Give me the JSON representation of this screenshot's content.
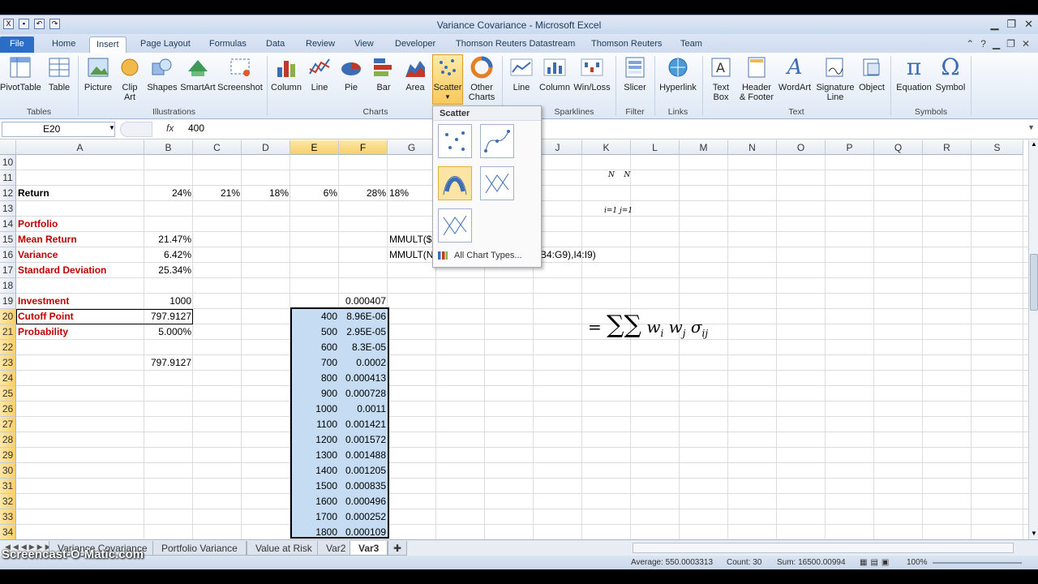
{
  "window": {
    "title": "Variance Covariance - Microsoft Excel"
  },
  "tabs": [
    "File",
    "Home",
    "Insert",
    "Page Layout",
    "Formulas",
    "Data",
    "Review",
    "View",
    "Developer",
    "Thomson Reuters Datastream",
    "Thomson Reuters",
    "Team"
  ],
  "ribbon": {
    "groups": {
      "tables": "Tables",
      "illustrations": "Illustrations",
      "charts": "Charts",
      "sparklines": "Sparklines",
      "filter": "Filter",
      "links": "Links",
      "text": "Text",
      "symbols": "Symbols"
    },
    "buttons": {
      "pivottable": "PivotTable",
      "table": "Table",
      "picture": "Picture",
      "clipart1": "Clip",
      "clipart2": "Art",
      "shapes": "Shapes",
      "smartart": "SmartArt",
      "screenshot": "Screenshot",
      "column": "Column",
      "line": "Line",
      "pie": "Pie",
      "bar": "Bar",
      "area": "Area",
      "scatter": "Scatter",
      "other1": "Other",
      "other2": "Charts",
      "sp_line": "Line",
      "sp_column": "Column",
      "sp_winloss": "Win/Loss",
      "slicer": "Slicer",
      "hyperlink": "Hyperlink",
      "textbox1": "Text",
      "textbox2": "Box",
      "header1": "Header",
      "header2": "& Footer",
      "wordart": "WordArt",
      "sig1": "Signature",
      "sig2": "Line",
      "object": "Object",
      "equation": "Equation",
      "symbol": "Symbol"
    }
  },
  "formula_bar": {
    "name_box": "E20",
    "fx": "fx",
    "value": "400"
  },
  "columns": [
    "A",
    "B",
    "C",
    "D",
    "E",
    "F",
    "G",
    "H",
    "I",
    "J",
    "K",
    "L",
    "M",
    "N",
    "O",
    "P",
    "Q",
    "R",
    "S"
  ],
  "rows": [
    "10",
    "11",
    "12",
    "13",
    "14",
    "15",
    "16",
    "17",
    "18",
    "19",
    "20",
    "21",
    "22",
    "23",
    "24",
    "25",
    "26",
    "27",
    "28",
    "29",
    "30",
    "31",
    "32",
    "33",
    "34"
  ],
  "cells": {
    "a12": "Return",
    "b12": "24%",
    "c12": "21%",
    "d12": "18%",
    "e12": "6%",
    "f12": "28%",
    "g12": "18%",
    "a14": "Portfolio",
    "a15": "Mean Return",
    "b15": "21.47%",
    "g15": "MMULT($",
    "a16": "Variance",
    "b16": "6.42%",
    "g16": "MMULT(N",
    "h16": "9),B4:G9),I4:I9)",
    "a17": "Standard Deviation",
    "b17": "25.34%",
    "a19": "Investment",
    "b19": "1000",
    "f19": "0.000407",
    "a20": "Cutoff Point",
    "b20": "797.9127",
    "a21": "Probability",
    "b21": "5.000%",
    "b23": "797.9127"
  },
  "ef_table": [
    [
      "400",
      "8.96E-06"
    ],
    [
      "500",
      "2.95E-05"
    ],
    [
      "600",
      "8.3E-05"
    ],
    [
      "700",
      "0.0002"
    ],
    [
      "800",
      "0.000413"
    ],
    [
      "900",
      "0.000728"
    ],
    [
      "1000",
      "0.0011"
    ],
    [
      "1100",
      "0.001421"
    ],
    [
      "1200",
      "0.001572"
    ],
    [
      "1300",
      "0.001488"
    ],
    [
      "1400",
      "0.001205"
    ],
    [
      "1500",
      "0.000835"
    ],
    [
      "1600",
      "0.000496"
    ],
    [
      "1700",
      "0.000252"
    ],
    [
      "1800",
      "0.000109"
    ]
  ],
  "dropdown": {
    "header": "Scatter",
    "all_chart_types": "All Chart Types..."
  },
  "sheet_tabs": [
    "Variance Covariance",
    "Portfolio Variance",
    "Value at Risk",
    "Var2",
    "Var3"
  ],
  "status": {
    "average": "Average: 550.0003313",
    "count": "Count: 30",
    "sum": "Sum: 16500.00994",
    "zoom": "100%"
  },
  "watermark": "Screencast-O-Matic.com"
}
